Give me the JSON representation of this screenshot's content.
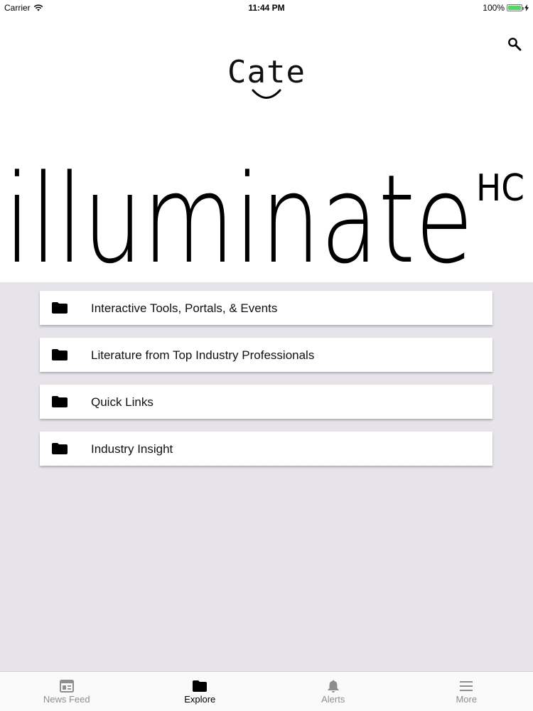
{
  "status_bar": {
    "carrier": "Carrier",
    "time": "11:44 PM",
    "battery": "100%",
    "battery_level": 1.0
  },
  "header": {
    "logo_text": "Cate",
    "search_icon": "search-icon",
    "banner_text": "illuminate",
    "banner_suffix": "HC"
  },
  "categories": [
    {
      "label": "Interactive Tools, Portals, & Events",
      "icon": "folder-icon"
    },
    {
      "label": "Literature from Top Industry Professionals",
      "icon": "folder-icon"
    },
    {
      "label": "Quick Links",
      "icon": "folder-icon"
    },
    {
      "label": "Industry Insight",
      "icon": "folder-icon"
    }
  ],
  "tab_bar": {
    "tabs": [
      {
        "label": "News Feed",
        "icon": "newspaper-icon",
        "active": false
      },
      {
        "label": "Explore",
        "icon": "folder-icon",
        "active": true
      },
      {
        "label": "Alerts",
        "icon": "bell-icon",
        "active": false
      },
      {
        "label": "More",
        "icon": "menu-icon",
        "active": false
      }
    ]
  },
  "colors": {
    "background": "#e6e4ea",
    "tab_active": "#000000",
    "tab_inactive": "#8e8e8e",
    "battery": "#4cd964"
  }
}
